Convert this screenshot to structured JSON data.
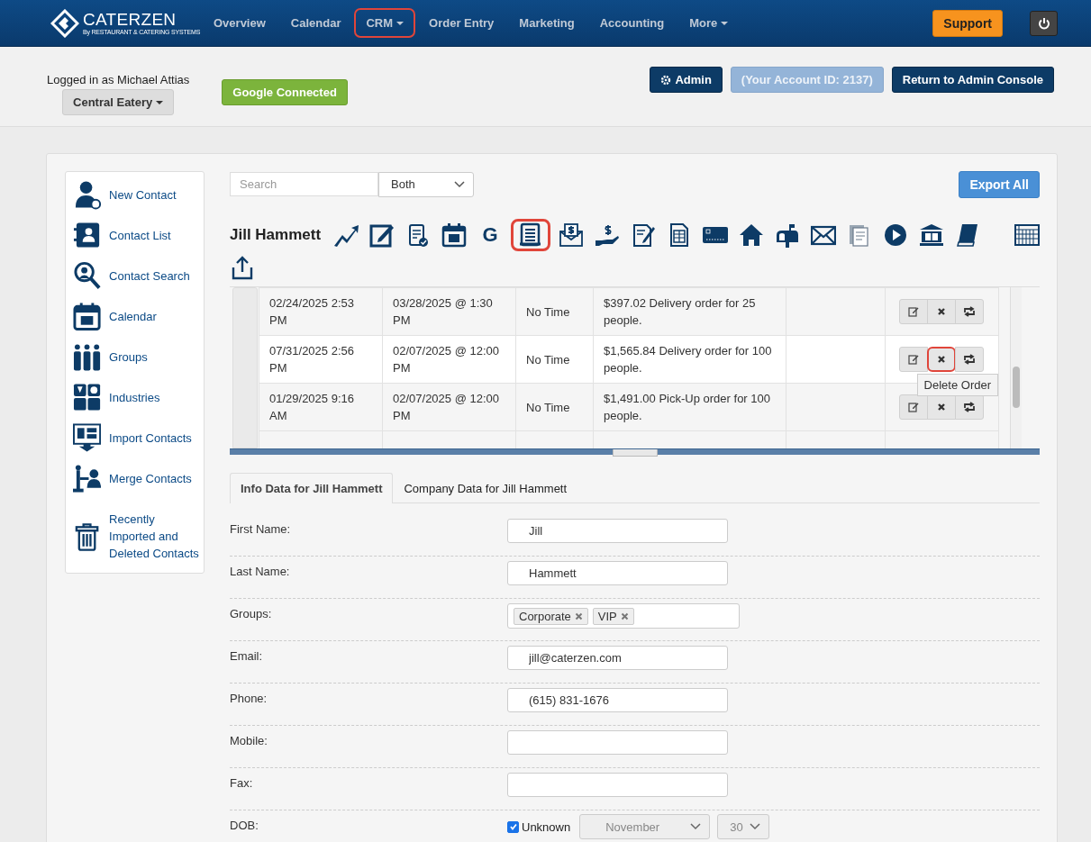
{
  "header": {
    "logo": {
      "name": "CATERZEN",
      "tagline": "By RESTAURANT & CATERING SYSTEMS"
    },
    "nav": [
      {
        "label": "Overview",
        "has_menu": false,
        "highlighted": false
      },
      {
        "label": "Calendar",
        "has_menu": false,
        "highlighted": false
      },
      {
        "label": "CRM",
        "has_menu": true,
        "highlighted": true
      },
      {
        "label": "Order Entry",
        "has_menu": false,
        "highlighted": false
      },
      {
        "label": "Marketing",
        "has_menu": false,
        "highlighted": false
      },
      {
        "label": "Accounting",
        "has_menu": false,
        "highlighted": false
      },
      {
        "label": "More",
        "has_menu": true,
        "highlighted": false
      }
    ],
    "support": "Support"
  },
  "account_bar": {
    "logged_in": "Logged in as Michael Attias",
    "location": "Central Eatery",
    "google": "Google Connected",
    "admin": "Admin",
    "account_id": "(Your Account ID: 2137)",
    "return": "Return to Admin Console"
  },
  "sidebar": {
    "items": [
      {
        "label": "New Contact",
        "kind": "person-add"
      },
      {
        "label": "Contact List",
        "kind": "contact-card"
      },
      {
        "label": "Contact Search",
        "kind": "search"
      },
      {
        "label": "Calendar",
        "kind": "calendar"
      },
      {
        "label": "Groups",
        "kind": "group"
      },
      {
        "label": "Industries",
        "kind": "industries"
      },
      {
        "label": "Import Contacts",
        "kind": "import"
      },
      {
        "label": "Merge Contacts",
        "kind": "merge"
      },
      {
        "label": "Recently Imported and Deleted Contacts",
        "kind": "trash"
      }
    ]
  },
  "search": {
    "placeholder": "Search",
    "scope": "Both",
    "export": "Export All"
  },
  "contact": {
    "name": "Jill Hammett",
    "tools": [
      {
        "kind": "chart",
        "highlighted": false
      },
      {
        "kind": "edit",
        "highlighted": false
      },
      {
        "kind": "checklist",
        "highlighted": false
      },
      {
        "kind": "calendar",
        "highlighted": false
      },
      {
        "kind": "letter",
        "text": "G",
        "highlighted": false
      },
      {
        "kind": "invoice",
        "highlighted": true
      },
      {
        "kind": "money-mail",
        "highlighted": false
      },
      {
        "kind": "payment",
        "highlighted": false
      },
      {
        "kind": "signed",
        "highlighted": false
      },
      {
        "kind": "sheet",
        "highlighted": false
      },
      {
        "kind": "card",
        "highlighted": false
      },
      {
        "kind": "house",
        "highlighted": false
      },
      {
        "kind": "mailbox",
        "highlighted": false
      },
      {
        "kind": "envelope",
        "highlighted": false
      },
      {
        "kind": "documents",
        "highlighted": false
      },
      {
        "kind": "play",
        "highlighted": false
      },
      {
        "kind": "bank",
        "highlighted": false
      },
      {
        "kind": "book",
        "highlighted": false
      },
      {
        "kind": "grid",
        "highlighted": false
      },
      {
        "kind": "upload",
        "highlighted": false
      }
    ]
  },
  "orders": {
    "rows": [
      {
        "created": "02/24/2025 2:53 PM",
        "event": "03/28/2025 @ 1:30 PM",
        "time": "No Time",
        "description": "$397.02 Delivery order for 25 people.",
        "delete_highlighted": false
      },
      {
        "created": "07/31/2025 2:56 PM",
        "event": "02/07/2025 @ 12:00 PM",
        "time": "No Time",
        "description": "$1,565.84 Delivery order for 100 people.",
        "delete_highlighted": true,
        "tooltip": "Delete Order"
      },
      {
        "created": "01/29/2025 9:16 AM",
        "event": "02/07/2025 @ 12:00 PM",
        "time": "No Time",
        "description": "$1,491.00 Pick-Up order for 100 people.",
        "delete_highlighted": false
      }
    ]
  },
  "tabs": [
    {
      "label": "Info Data for Jill Hammett",
      "selected": true
    },
    {
      "label": "Company Data for Jill Hammett",
      "selected": false
    }
  ],
  "fields": [
    {
      "label": "First Name:",
      "kind": "text",
      "value": "Jill"
    },
    {
      "label": "Last Name:",
      "kind": "text",
      "value": "Hammett"
    },
    {
      "label": "Groups:",
      "kind": "tags",
      "values": [
        "Corporate",
        "VIP"
      ]
    },
    {
      "label": "Email:",
      "kind": "text",
      "value": "jill@caterzen.com"
    },
    {
      "label": "Phone:",
      "kind": "text",
      "value": "(615) 831-1676"
    },
    {
      "label": "Mobile:",
      "kind": "text"
    },
    {
      "label": "Fax:",
      "kind": "text"
    },
    {
      "label": "DOB:",
      "kind": "dob",
      "checkbox": "Unknown",
      "checked": true,
      "month": "November",
      "day": "30"
    }
  ]
}
